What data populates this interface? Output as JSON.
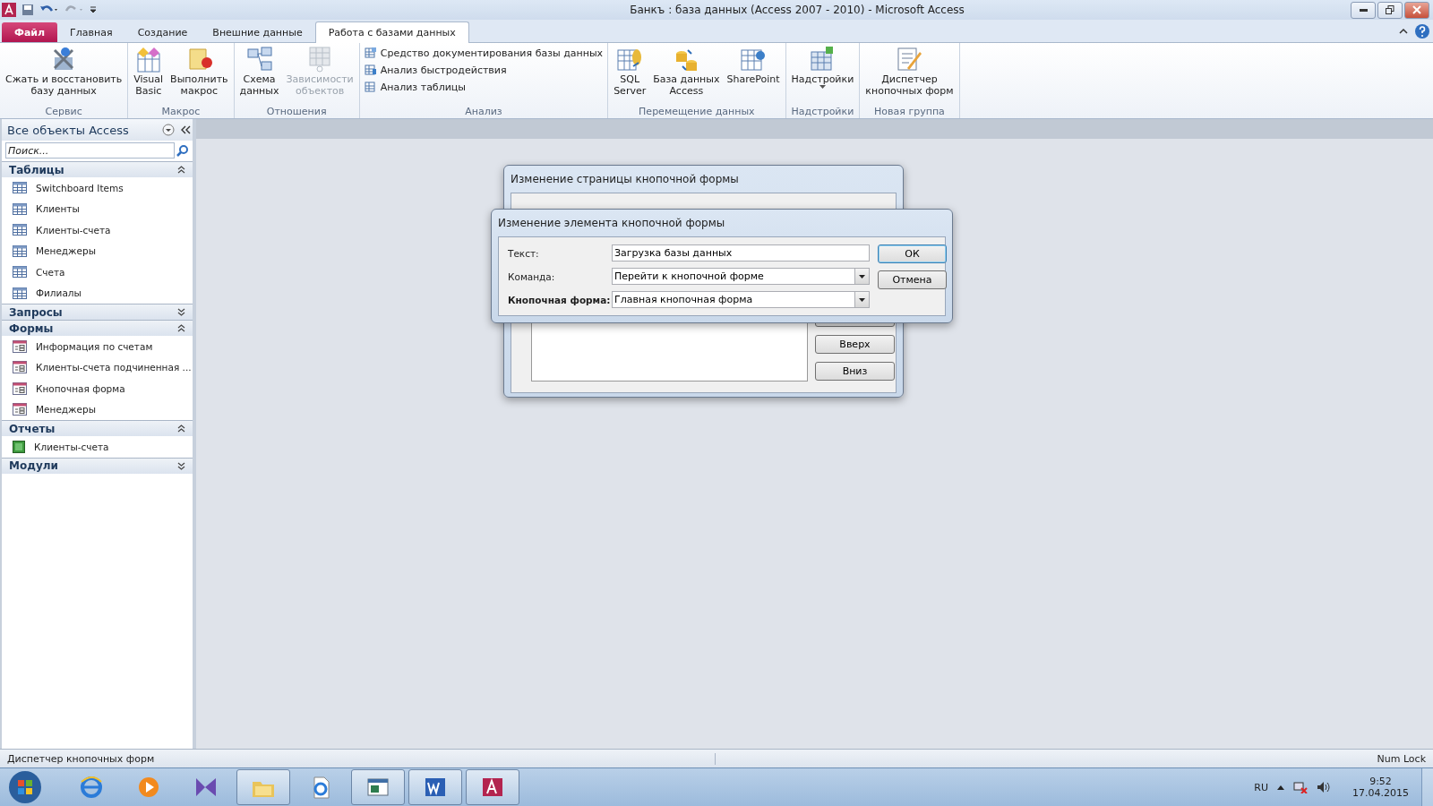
{
  "window": {
    "title": "Банкъ : база данных (Access 2007 - 2010)  -  Microsoft Access"
  },
  "tabs": [
    {
      "label": "Файл",
      "kind": "file",
      "selected": false
    },
    {
      "label": "Главная",
      "kind": "tab",
      "selected": false
    },
    {
      "label": "Создание",
      "kind": "tab",
      "selected": false
    },
    {
      "label": "Внешние данные",
      "kind": "tab",
      "selected": false
    },
    {
      "label": "Работа с базами данных",
      "kind": "tab",
      "selected": true
    }
  ],
  "ribbon": [
    {
      "name": "Сервис",
      "items": [
        {
          "kind": "large",
          "label": [
            "Сжать и восстановить",
            "базу данных"
          ],
          "disabled": false
        }
      ]
    },
    {
      "name": "Макрос",
      "items": [
        {
          "kind": "large",
          "label": [
            "Visual",
            "Basic"
          ],
          "disabled": false
        },
        {
          "kind": "large",
          "label": [
            "Выполнить",
            "макрос"
          ],
          "disabled": false
        }
      ]
    },
    {
      "name": "Отношения",
      "items": [
        {
          "kind": "large",
          "label": [
            "Схема",
            "данных"
          ],
          "disabled": false
        },
        {
          "kind": "large",
          "label": [
            "Зависимости",
            "объектов"
          ],
          "disabled": true
        }
      ]
    },
    {
      "name": "Анализ",
      "items": [
        {
          "kind": "small",
          "label": [
            "Средство документирования базы данных"
          ],
          "disabled": false
        },
        {
          "kind": "small",
          "label": [
            "Анализ быстродействия"
          ],
          "disabled": false
        },
        {
          "kind": "small",
          "label": [
            "Анализ таблицы"
          ],
          "disabled": false
        }
      ]
    },
    {
      "name": "Перемещение данных",
      "items": [
        {
          "kind": "large",
          "label": [
            "SQL",
            "Server"
          ],
          "disabled": false
        },
        {
          "kind": "large",
          "label": [
            "База данных",
            "Access"
          ],
          "disabled": false
        },
        {
          "kind": "large",
          "label": [
            "SharePoint"
          ],
          "disabled": false
        }
      ]
    },
    {
      "name": "Надстройки",
      "items": [
        {
          "kind": "menu",
          "label": [
            "Надстройки"
          ],
          "disabled": false
        }
      ]
    },
    {
      "name": "Новая группа",
      "items": [
        {
          "kind": "large",
          "label": [
            "Диспетчер",
            "кнопочных форм"
          ],
          "disabled": false
        }
      ]
    }
  ],
  "nav": {
    "title": "Все объекты Access",
    "search": {
      "placeholder": "Поиск..."
    },
    "groups": [
      {
        "name": "Таблицы",
        "expanded": true,
        "items": [
          {
            "label": "Switchboard Items",
            "kind": "table"
          },
          {
            "label": "Клиенты",
            "kind": "table"
          },
          {
            "label": "Клиенты-счета",
            "kind": "table"
          },
          {
            "label": "Менеджеры",
            "kind": "table"
          },
          {
            "label": "Счета",
            "kind": "table"
          },
          {
            "label": "Филиалы",
            "kind": "table"
          }
        ]
      },
      {
        "name": "Запросы",
        "expanded": false
      },
      {
        "name": "Формы",
        "expanded": true,
        "items": [
          {
            "label": "Информация по счетам",
            "kind": "form"
          },
          {
            "label": "Клиенты-счета подчиненная ...",
            "kind": "form"
          },
          {
            "label": "Кнопочная форма",
            "kind": "form"
          },
          {
            "label": "Менеджеры",
            "kind": "form"
          }
        ]
      },
      {
        "name": "Отчеты",
        "expanded": true,
        "items": [
          {
            "label": "Клиенты-счета",
            "kind": "report"
          }
        ]
      },
      {
        "name": "Модули",
        "expanded": false
      }
    ]
  },
  "back_dialog": {
    "title": "Изменение страницы кнопочной формы",
    "buttons": [
      "Вверх",
      "Вниз"
    ]
  },
  "dialog": {
    "title": "Изменение элемента кнопочной формы",
    "fields": [
      {
        "label": "Текст:",
        "kind": "text",
        "value": "Загрузка базы данных"
      },
      {
        "label": "Команда:",
        "kind": "combo",
        "value": "Перейти к кнопочной форме"
      },
      {
        "label": "Кнопочная форма:",
        "kind": "combo",
        "value": "Главная кнопочная форма"
      }
    ],
    "buttons": [
      {
        "label": "ОК",
        "default": true
      },
      {
        "label": "Отмена",
        "default": false
      }
    ]
  },
  "status_bar": {
    "text": "Диспетчер кнопочных форм",
    "indicator": "Num Lock"
  },
  "taskbar": {
    "apps": [
      {
        "active": false
      },
      {
        "active": false
      },
      {
        "active": false
      },
      {
        "active": true
      },
      {
        "active": false
      },
      {
        "active": true
      },
      {
        "active": true
      },
      {
        "active": true
      }
    ],
    "language": "RU",
    "time": "9:52",
    "date": "17.04.2015"
  }
}
